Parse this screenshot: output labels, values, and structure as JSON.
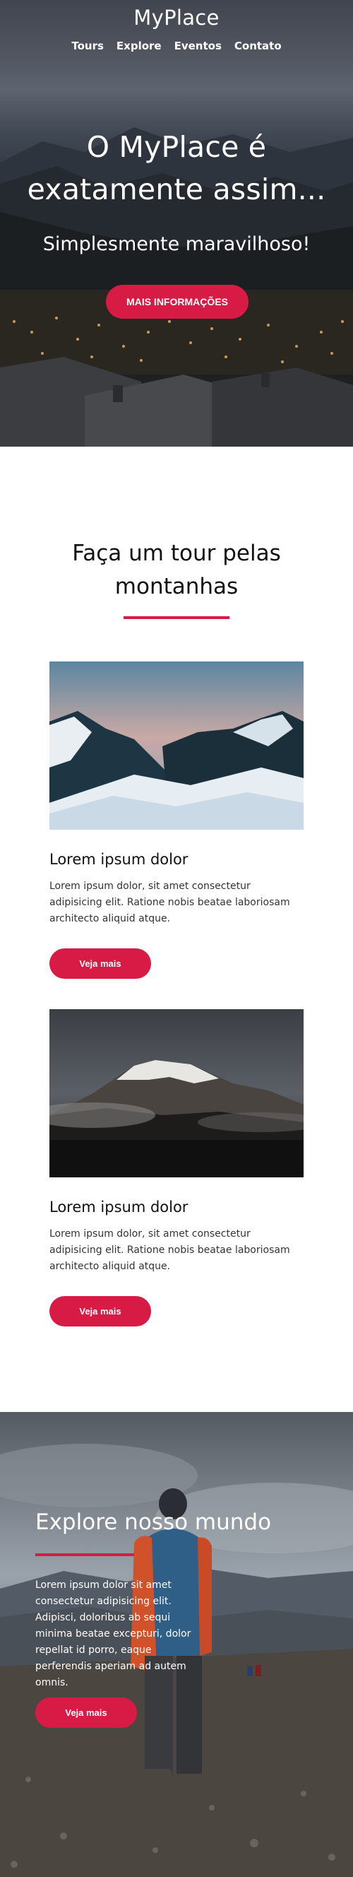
{
  "header": {
    "brand": "MyPlace",
    "nav": [
      "Tours",
      "Explore",
      "Eventos",
      "Contato"
    ]
  },
  "hero": {
    "headline": "O MyPlace é exatamente assim...",
    "tagline": "Simplesmente maravilhoso!",
    "cta_label": "MAIS INFORMAÇÕES"
  },
  "tours": {
    "title": "Faça um tour pelas montanhas",
    "cards": [
      {
        "title": "Lorem ipsum dolor",
        "text": "Lorem ipsum dolor, sit amet consectetur adipisicing elit. Ratione nobis beatae laboriosam architecto aliquid atque.",
        "button": "Veja mais"
      },
      {
        "title": "Lorem ipsum dolor",
        "text": "Lorem ipsum dolor, sit amet consectetur adipisicing elit. Ratione nobis beatae laboriosam architecto aliquid atque.",
        "button": "Veja mais"
      }
    ]
  },
  "explore": {
    "title": "Explore nosso mundo",
    "text": "Lorem ipsum dolor sit amet consectetur adipisicing elit. Adipisci, doloribus ab sequi minima beatae excepturi, dolor repellat id porro, eaque perferendis aperiam ad autem omnis.",
    "button": "Veja mais"
  },
  "colors": {
    "accent": "#d81b45",
    "text": "#111111"
  }
}
